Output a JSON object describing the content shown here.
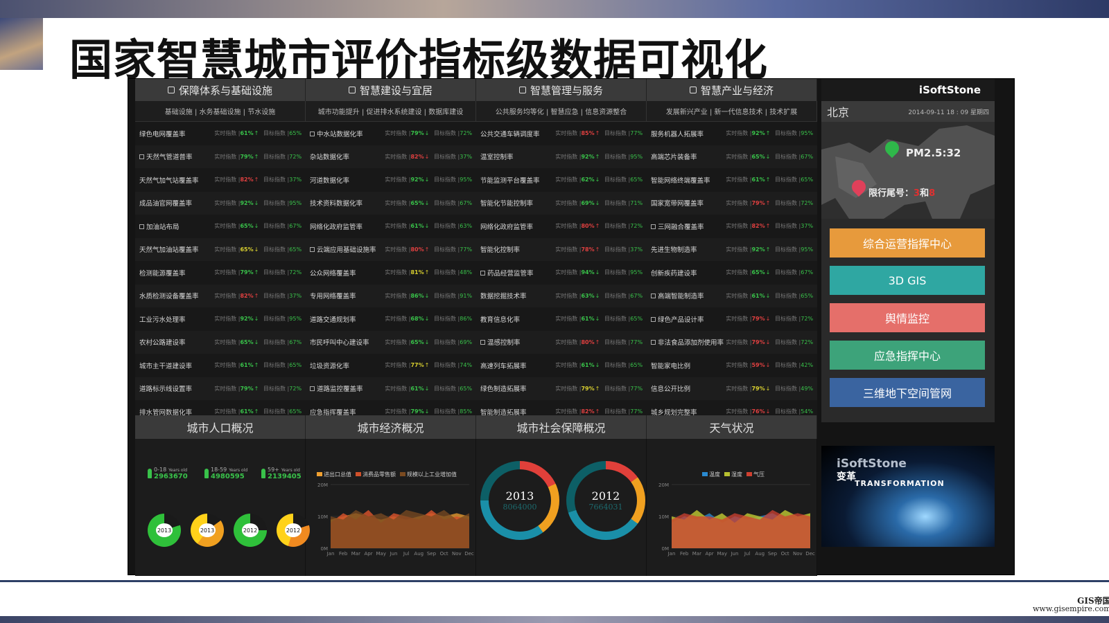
{
  "slide_title": "国家智慧城市评价指标级数据可视化",
  "watermark": {
    "line1": "GIS帝国",
    "line2": "www.gisempire.com"
  },
  "brand": "iSoftStone",
  "groups": [
    {
      "title": "保障体系与基础设施",
      "subtitle": "基础设施 | 水务基础设施 | 节水设施",
      "rows": [
        {
          "name": "绿色电网覆盖率",
          "check": false,
          "actual": "61%",
          "acolor": "g",
          "dir": "↑",
          "target": "65%"
        },
        {
          "name": "天然气管道普率",
          "check": true,
          "actual": "79%",
          "acolor": "g",
          "dir": "↑",
          "target": "72%"
        },
        {
          "name": "天然气加气站覆盖率",
          "check": false,
          "actual": "82%",
          "acolor": "r",
          "dir": "↑",
          "target": "37%"
        },
        {
          "name": "成品油官网覆盖率",
          "check": false,
          "actual": "92%",
          "acolor": "g",
          "dir": "↓",
          "target": "95%"
        },
        {
          "name": "加油站布局",
          "check": true,
          "actual": "65%",
          "acolor": "g",
          "dir": "↓",
          "target": "67%"
        },
        {
          "name": "天然气加油站覆盖率",
          "check": false,
          "actual": "65%",
          "acolor": "y",
          "dir": "↓",
          "target": "65%"
        },
        {
          "name": "检测能源覆盖率",
          "check": false,
          "actual": "79%",
          "acolor": "g",
          "dir": "↑",
          "target": "72%"
        },
        {
          "name": "水质检测设备覆盖率",
          "check": false,
          "actual": "82%",
          "acolor": "r",
          "dir": "↑",
          "target": "37%"
        },
        {
          "name": "工业污水处理率",
          "check": false,
          "actual": "92%",
          "acolor": "g",
          "dir": "↓",
          "target": "95%"
        },
        {
          "name": "农村公路建设率",
          "check": false,
          "actual": "65%",
          "acolor": "g",
          "dir": "↓",
          "target": "67%"
        },
        {
          "name": "城市主干道建设率",
          "check": false,
          "actual": "61%",
          "acolor": "g",
          "dir": "↑",
          "target": "65%"
        },
        {
          "name": "道路标示线设置率",
          "check": false,
          "actual": "79%",
          "acolor": "g",
          "dir": "↑",
          "target": "72%"
        },
        {
          "name": "排水管网数据化率",
          "check": false,
          "actual": "61%",
          "acolor": "g",
          "dir": "↑",
          "target": "65%"
        }
      ]
    },
    {
      "title": "智慧建设与宜居",
      "subtitle": "城市功能提升 | 促进排水系统建设 | 数据库建设",
      "rows": [
        {
          "name": "中水站数据化率",
          "check": true,
          "actual": "79%",
          "acolor": "g",
          "dir": "↓",
          "target": "72%"
        },
        {
          "name": "杂站数据化率",
          "check": false,
          "actual": "82%",
          "acolor": "r",
          "dir": "↓",
          "target": "37%"
        },
        {
          "name": "河道数据化率",
          "check": false,
          "actual": "92%",
          "acolor": "g",
          "dir": "↓",
          "target": "95%"
        },
        {
          "name": "技术资料数据化率",
          "check": false,
          "actual": "65%",
          "acolor": "g",
          "dir": "↓",
          "target": "67%"
        },
        {
          "name": "网络化政府监管率",
          "check": false,
          "actual": "61%",
          "acolor": "g",
          "dir": "↓",
          "target": "63%"
        },
        {
          "name": "云端应用基础设施率",
          "check": true,
          "actual": "80%",
          "acolor": "r",
          "dir": "↑",
          "target": "77%"
        },
        {
          "name": "公众网络覆盖率",
          "check": false,
          "actual": "81%",
          "acolor": "y",
          "dir": "↑",
          "target": "48%"
        },
        {
          "name": "专用网络覆盖率",
          "check": false,
          "actual": "86%",
          "acolor": "g",
          "dir": "↓",
          "target": "91%"
        },
        {
          "name": "道路交通规划率",
          "check": false,
          "actual": "68%",
          "acolor": "g",
          "dir": "↓",
          "target": "86%"
        },
        {
          "name": "市民呼叫中心建设率",
          "check": false,
          "actual": "65%",
          "acolor": "g",
          "dir": "↓",
          "target": "69%"
        },
        {
          "name": "垃圾资源化率",
          "check": false,
          "actual": "77%",
          "acolor": "y",
          "dir": "↑",
          "target": "74%"
        },
        {
          "name": "道路监控覆盖率",
          "check": true,
          "actual": "61%",
          "acolor": "g",
          "dir": "↓",
          "target": "65%"
        },
        {
          "name": "应急指挥覆盖率",
          "check": false,
          "actual": "79%",
          "acolor": "g",
          "dir": "↓",
          "target": "85%"
        }
      ]
    },
    {
      "title": "智慧管理与服务",
      "subtitle": "公共服务均等化 | 智慧应急 | 信息资源整合",
      "rows": [
        {
          "name": "公共交通车辆调度率",
          "check": false,
          "actual": "85%",
          "acolor": "r",
          "dir": "↑",
          "target": "77%"
        },
        {
          "name": "温室控制率",
          "check": false,
          "actual": "92%",
          "acolor": "g",
          "dir": "↑",
          "target": "95%"
        },
        {
          "name": "节能监测平台覆盖率",
          "check": false,
          "actual": "62%",
          "acolor": "g",
          "dir": "↓",
          "target": "65%"
        },
        {
          "name": "智能化节能控制率",
          "check": false,
          "actual": "69%",
          "acolor": "g",
          "dir": "↓",
          "target": "71%"
        },
        {
          "name": "网络化政府监管率",
          "check": false,
          "actual": "80%",
          "acolor": "r",
          "dir": "↑",
          "target": "72%"
        },
        {
          "name": "智能化控制率",
          "check": false,
          "actual": "78%",
          "acolor": "r",
          "dir": "↑",
          "target": "37%"
        },
        {
          "name": "药品经营监管率",
          "check": true,
          "actual": "94%",
          "acolor": "g",
          "dir": "↓",
          "target": "95%"
        },
        {
          "name": "数据挖掘技术率",
          "check": false,
          "actual": "63%",
          "acolor": "g",
          "dir": "↓",
          "target": "67%"
        },
        {
          "name": "教育信息化率",
          "check": false,
          "actual": "61%",
          "acolor": "g",
          "dir": "↓",
          "target": "65%"
        },
        {
          "name": "温感控制率",
          "check": true,
          "actual": "80%",
          "acolor": "r",
          "dir": "↑",
          "target": "77%"
        },
        {
          "name": "高速列车拓展率",
          "check": false,
          "actual": "61%",
          "acolor": "g",
          "dir": "↓",
          "target": "65%"
        },
        {
          "name": "绿色制造拓展率",
          "check": false,
          "actual": "79%",
          "acolor": "y",
          "dir": "↑",
          "target": "77%"
        },
        {
          "name": "智能制造拓展率",
          "check": false,
          "actual": "82%",
          "acolor": "r",
          "dir": "↑",
          "target": "77%"
        }
      ]
    },
    {
      "title": "智慧产业与经济",
      "subtitle": "发展新兴产业 | 新一代信息技术 | 技术扩展",
      "rows": [
        {
          "name": "服务机器人拓展率",
          "check": false,
          "actual": "92%",
          "acolor": "g",
          "dir": "↑",
          "target": "95%"
        },
        {
          "name": "高端芯片装备率",
          "check": false,
          "actual": "65%",
          "acolor": "g",
          "dir": "↓",
          "target": "67%"
        },
        {
          "name": "智能网络终端覆盖率",
          "check": false,
          "actual": "61%",
          "acolor": "g",
          "dir": "↑",
          "target": "65%"
        },
        {
          "name": "国家宽带网覆盖率",
          "check": false,
          "actual": "79%",
          "acolor": "r",
          "dir": "↑",
          "target": "72%"
        },
        {
          "name": "三网融合覆盖率",
          "check": true,
          "actual": "82%",
          "acolor": "r",
          "dir": "↑",
          "target": "37%"
        },
        {
          "name": "先进生物制造率",
          "check": false,
          "actual": "92%",
          "acolor": "g",
          "dir": "↑",
          "target": "95%"
        },
        {
          "name": "创新疾药建设率",
          "check": false,
          "actual": "65%",
          "acolor": "g",
          "dir": "↓",
          "target": "67%"
        },
        {
          "name": "高端智能制造率",
          "check": true,
          "actual": "61%",
          "acolor": "g",
          "dir": "↓",
          "target": "65%"
        },
        {
          "name": "绿色产品设计率",
          "check": true,
          "actual": "79%",
          "acolor": "r",
          "dir": "↓",
          "target": "72%"
        },
        {
          "name": "非法食品添加剂使用率",
          "check": true,
          "actual": "79%",
          "acolor": "r",
          "dir": "↓",
          "target": "72%"
        },
        {
          "name": "智能家电比例",
          "check": false,
          "actual": "59%",
          "acolor": "r",
          "dir": "↓",
          "target": "42%"
        },
        {
          "name": "信息公开比例",
          "check": false,
          "actual": "79%",
          "acolor": "y",
          "dir": "↓",
          "target": "49%"
        },
        {
          "name": "城乡规划完整率",
          "check": false,
          "actual": "76%",
          "acolor": "r",
          "dir": "↓",
          "target": "54%"
        }
      ]
    }
  ],
  "row_labels": {
    "actual": "实时指数 |",
    "target": "目标指数 |"
  },
  "right_panel": {
    "city": "北京",
    "datetime": "2014-09-11   18 : 09   星期四",
    "pm25": "PM2.5:32",
    "limit_label": "限行尾号：",
    "limit_a": "3",
    "limit_sep": "和",
    "limit_b": "8",
    "buttons": [
      {
        "label": "综合运营指挥中心",
        "color": "#e79a3c"
      },
      {
        "label": "3D GIS",
        "color": "#2fa7a2"
      },
      {
        "label": "舆情监控",
        "color": "#e56f6a"
      },
      {
        "label": "应急指挥中心",
        "color": "#3da37a"
      },
      {
        "label": "三维地下空间管网",
        "color": "#3a64a0"
      }
    ]
  },
  "bottom": {
    "population": {
      "title": "城市人口概况",
      "groups": [
        {
          "age": "0-18",
          "sub": "Years old",
          "value": "2963670"
        },
        {
          "age": "18-59",
          "sub": "Years old",
          "value": "4980595"
        },
        {
          "age": "59+",
          "sub": "Years old",
          "value": "2139405"
        }
      ],
      "donuts": [
        "2013",
        "2013",
        "2012",
        "2012"
      ]
    },
    "economy": {
      "title": "城市经济概况",
      "legend": [
        "进出口总值",
        "消费品零售额",
        "规模以上工业增加值"
      ]
    },
    "social": {
      "title": "城市社会保障概况",
      "rings": [
        {
          "year": "2013",
          "value": "8064000"
        },
        {
          "year": "2012",
          "value": "7664031"
        }
      ]
    },
    "weather": {
      "title": "天气状况",
      "legend": [
        "温度",
        "湿度",
        "气压"
      ]
    },
    "video": {
      "brand": "iSoftStone",
      "line2": "变革",
      "line3": "TRANSFORMATION"
    }
  },
  "chart_data": [
    {
      "type": "area",
      "title": "城市经济概况",
      "x": [
        "Jan",
        "Feb",
        "Mar",
        "Apr",
        "May",
        "Jun",
        "Jul",
        "Aug",
        "Sep",
        "Oct",
        "Nov",
        "Dec"
      ],
      "ylim": [
        0,
        20
      ],
      "ytick_labels": [
        "0M",
        "10M",
        "20M"
      ],
      "series": [
        {
          "name": "进出口总值",
          "color": "#f0a030",
          "values": [
            9,
            10,
            11,
            10,
            9,
            10,
            9,
            10,
            11,
            10,
            11,
            10
          ]
        },
        {
          "name": "消费品零售额",
          "color": "#d0502a",
          "values": [
            8,
            11,
            9,
            12,
            8,
            11,
            10,
            9,
            12,
            9,
            10,
            9
          ]
        },
        {
          "name": "规模以上工业增加值",
          "color": "#7a4a20",
          "values": [
            10,
            9,
            12,
            10,
            11,
            9,
            12,
            11,
            10,
            12,
            9,
            11
          ]
        }
      ]
    },
    {
      "type": "area",
      "title": "天气状况",
      "x": [
        "Jan",
        "Feb",
        "Mar",
        "Apr",
        "May",
        "Jun",
        "Jul",
        "Aug",
        "Sep",
        "Oct",
        "Nov",
        "Dec"
      ],
      "ylim": [
        0,
        20
      ],
      "ytick_labels": [
        "0M",
        "10M",
        "20M"
      ],
      "series": [
        {
          "name": "温度",
          "color": "#2a8ad0",
          "values": [
            8,
            10,
            9,
            11,
            8,
            10,
            9,
            10,
            11,
            9,
            10,
            9
          ]
        },
        {
          "name": "湿度",
          "color": "#b7c030",
          "values": [
            10,
            9,
            12,
            9,
            11,
            8,
            11,
            10,
            9,
            12,
            10,
            11
          ]
        },
        {
          "name": "气压",
          "color": "#d04030",
          "values": [
            9,
            11,
            10,
            10,
            9,
            11,
            10,
            9,
            12,
            10,
            11,
            10
          ]
        }
      ]
    }
  ]
}
